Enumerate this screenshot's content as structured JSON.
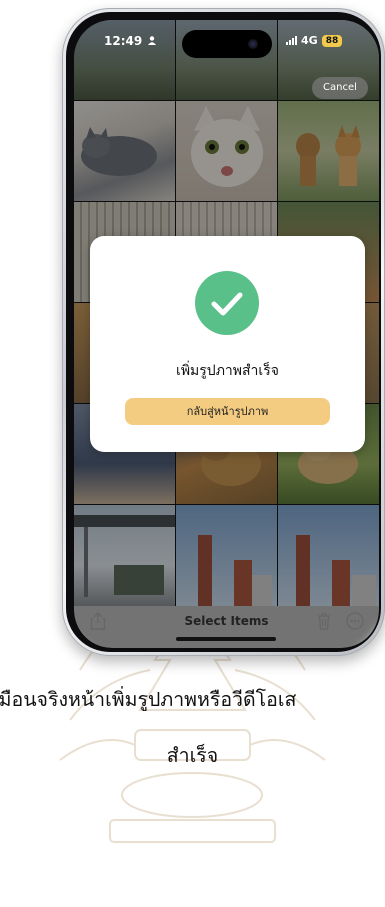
{
  "status_bar": {
    "time": "12:49",
    "network": "4G",
    "battery": "88"
  },
  "photos_header": {
    "cancel_label": "Cancel"
  },
  "modal": {
    "title": "เพิ่มรูปภาพสำเร็จ",
    "button_label": "กลับสู่หน้ารูปภาพ"
  },
  "toolbar": {
    "title": "Select Items"
  },
  "caption": {
    "line1": "เมือนจริงหน้าเพิ่มรูปภาพหรือวีดีโอเส",
    "line2": "สำเร็จ"
  },
  "colors": {
    "success": "#5ac08a",
    "modal_button": "#f3cc82",
    "battery_badge": "#f2c94c"
  },
  "icons": [
    "share-icon",
    "trash-icon",
    "more-icon",
    "checkmark-icon",
    "person-icon",
    "signal-icon"
  ]
}
